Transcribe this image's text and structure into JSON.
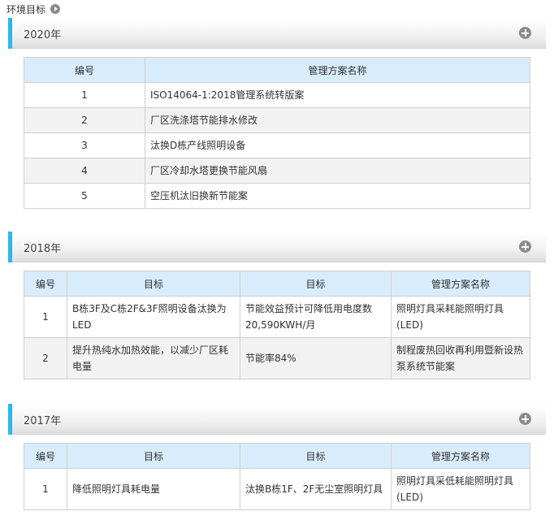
{
  "page": {
    "title": "环境目标"
  },
  "sections": [
    {
      "year": "2020年",
      "headers": [
        "编号",
        "管理方案名称"
      ],
      "rows": [
        [
          "1",
          "ISO14064-1:2018管理系统转版案"
        ],
        [
          "2",
          "厂区洗涤塔节能排水修改"
        ],
        [
          "3",
          "汰换D栋产线照明设备"
        ],
        [
          "4",
          "厂区冷却水塔更换节能风扇"
        ],
        [
          "5",
          "空压机汰旧换新节能案"
        ]
      ]
    },
    {
      "year": "2018年",
      "headers": [
        "编号",
        "目标",
        "目标",
        "管理方案名称"
      ],
      "rows": [
        [
          "1",
          "B栋3F及C栋2F&3F照明设备汰换为LED",
          "节能效益预计可降低用电度数20,590KWH/月",
          "照明灯具采耗能照明灯具(LED)"
        ],
        [
          "2",
          "提升热纯水加热效能，以减少厂区耗电量",
          "节能率84%",
          "制程废热回收再利用暨新设热泵系统节能案"
        ]
      ]
    },
    {
      "year": "2017年",
      "headers": [
        "编号",
        "目标",
        "目标",
        "管理方案名称"
      ],
      "rows": [
        [
          "1",
          "降低照明灯具耗电量",
          "汰换B栋1F、2F无尘室照明灯具",
          "照明灯具采低耗能照明灯具(LED)"
        ]
      ]
    }
  ]
}
